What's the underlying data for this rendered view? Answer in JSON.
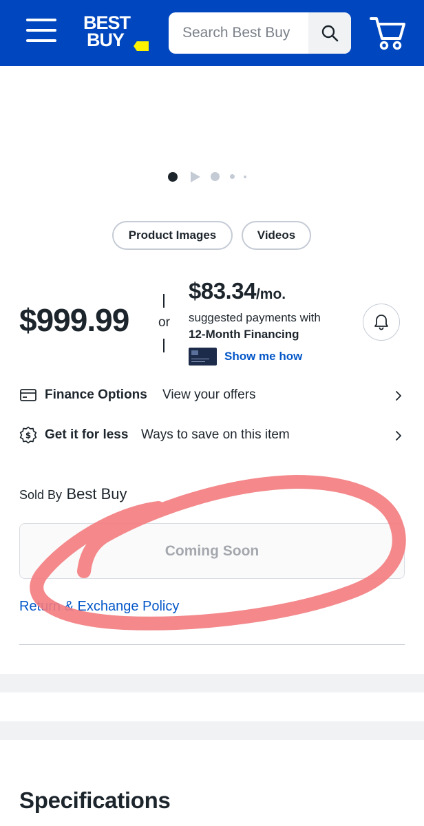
{
  "header": {
    "logo_line1": "BEST",
    "logo_line2": "BUY",
    "search_placeholder": "Search Best Buy",
    "brand_color": "#0046be",
    "logo_tag_color": "#fff200",
    "icons": [
      "menu-icon",
      "search-icon",
      "cart-icon"
    ]
  },
  "carousel": {
    "slide_count": 5,
    "active_index": 0
  },
  "media_buttons": {
    "images_label": "Product Images",
    "videos_label": "Videos"
  },
  "pricing": {
    "price": "$999.99",
    "or": "or",
    "monthly_amount": "$83.34",
    "monthly_unit": "/mo.",
    "suggested_text": "suggested payments with",
    "financing_term": "12-Month Financing",
    "show_me_how": "Show me how"
  },
  "finance_row": {
    "title": "Finance Options",
    "subtitle": "View your offers"
  },
  "save_row": {
    "title": "Get it for less",
    "subtitle": "Ways to save on this item"
  },
  "seller": {
    "label": "Sold By",
    "name": "Best Buy"
  },
  "availability": {
    "button_label": "Coming Soon"
  },
  "policy": {
    "link_text": "Return & Exchange Policy"
  },
  "sections": {
    "specifications_heading": "Specifications"
  },
  "annotation": {
    "color": "#f37b7e"
  }
}
